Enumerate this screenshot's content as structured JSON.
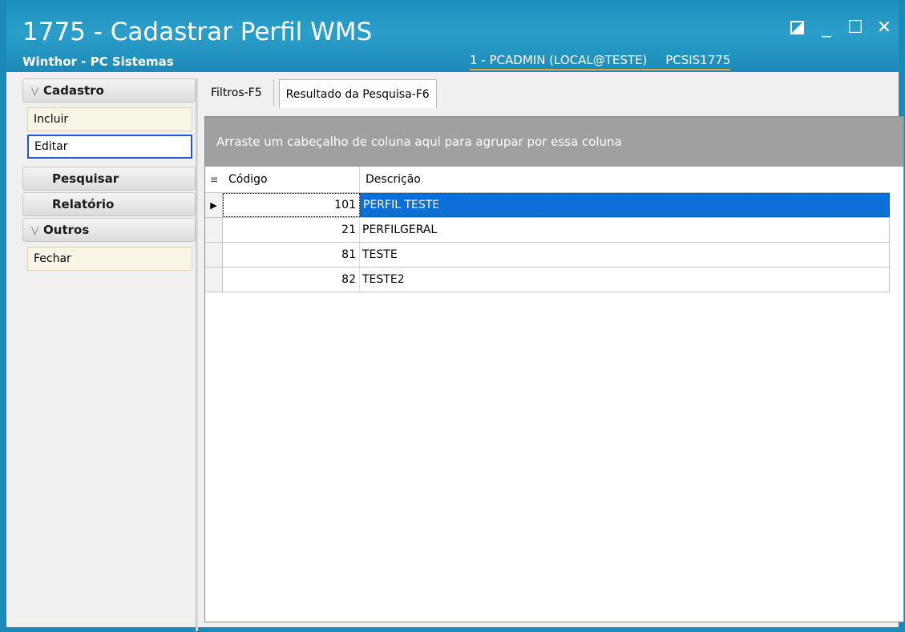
{
  "window": {
    "title": "1775 - Cadastrar Perfil WMS",
    "subtitle": "Winthor - PC Sistemas",
    "user": "1 - PCADMIN (LOCAL@TESTE)",
    "program": "PCSIS1775",
    "controls": {
      "restore_icon": "restore-icon",
      "minimize_glyph": "_",
      "maximize_glyph": "☐",
      "close_glyph": "✕"
    }
  },
  "sidebar": {
    "cadastro": {
      "label": "Cadastro",
      "items": [
        {
          "label": "Incluir"
        },
        {
          "label": "Editar"
        }
      ]
    },
    "pesquisar": {
      "label": "Pesquisar"
    },
    "relatorio": {
      "label": "Relatório"
    },
    "outros": {
      "label": "Outros",
      "items": [
        {
          "label": "Fechar"
        }
      ]
    }
  },
  "tabs": [
    {
      "label": "Filtros-F5"
    },
    {
      "label": "Resultado da Pesquisa-F6"
    }
  ],
  "grid": {
    "group_hint": "Arraste um cabeçalho de coluna aqui para agrupar por essa coluna",
    "columns": {
      "code": "Código",
      "description": "Descrição"
    },
    "rows": [
      {
        "code": "101",
        "description": "PERFIL TESTE"
      },
      {
        "code": "21",
        "description": "PERFILGERAL"
      },
      {
        "code": "81",
        "description": "TESTE"
      },
      {
        "code": "82",
        "description": "TESTE2"
      }
    ]
  },
  "colors": {
    "titlebar": "#1c8ab8",
    "selection": "#0a6fd6",
    "active_border": "#2b4fdc",
    "group_panel": "#a0a0a0"
  }
}
